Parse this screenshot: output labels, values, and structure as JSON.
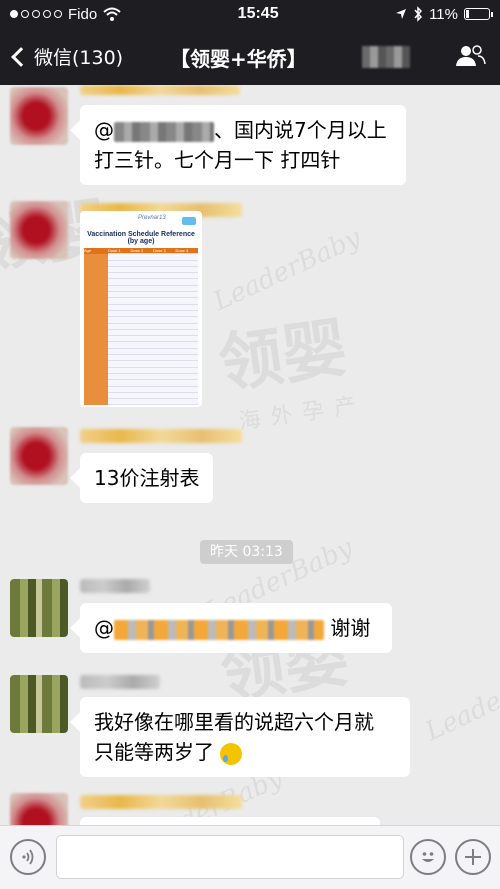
{
  "status_bar": {
    "carrier": "Fido",
    "time": "15:45",
    "battery": "11%"
  },
  "nav": {
    "back_label": "微信(130)",
    "title": "【领婴+华侨】"
  },
  "messages": [
    {
      "text_suffix": "国内说7个月以上打三针。七个月一下 打四针",
      "line1": "、国内说7个月以上",
      "line2": "打三针。七个月一下 打四针"
    },
    {
      "image": {
        "title": "Vaccination Schedule Reference (by age)",
        "logo": "Prevnar13",
        "columns": [
          "Age",
          "Dose 1",
          "Dose 2",
          "Dose 3",
          "Dose 4"
        ]
      }
    },
    {
      "text": "13价注射表"
    },
    {
      "timestamp": "昨天 03:13"
    },
    {
      "text_suffix": "谢谢"
    },
    {
      "line1": "我好像在哪里看的说超六个月就",
      "line2": "只能等两岁了"
    }
  ],
  "watermark": {
    "brand_en": "LeaderBaby",
    "brand_cn": "领婴",
    "tagline_cn": "海外孕产"
  },
  "icons": {
    "signal": "signal-dots-icon",
    "wifi": "wifi-icon",
    "location": "location-arrow-icon",
    "bluetooth": "bluetooth-icon",
    "battery": "battery-icon",
    "back": "chevron-left-icon",
    "group": "people-icon",
    "voice": "voice-icon",
    "emoji": "emoji-icon",
    "add": "plus-icon"
  },
  "colors": {
    "nav_bg": "#1e1e22",
    "chat_bg": "#ebebeb",
    "bubble": "#ffffff"
  }
}
